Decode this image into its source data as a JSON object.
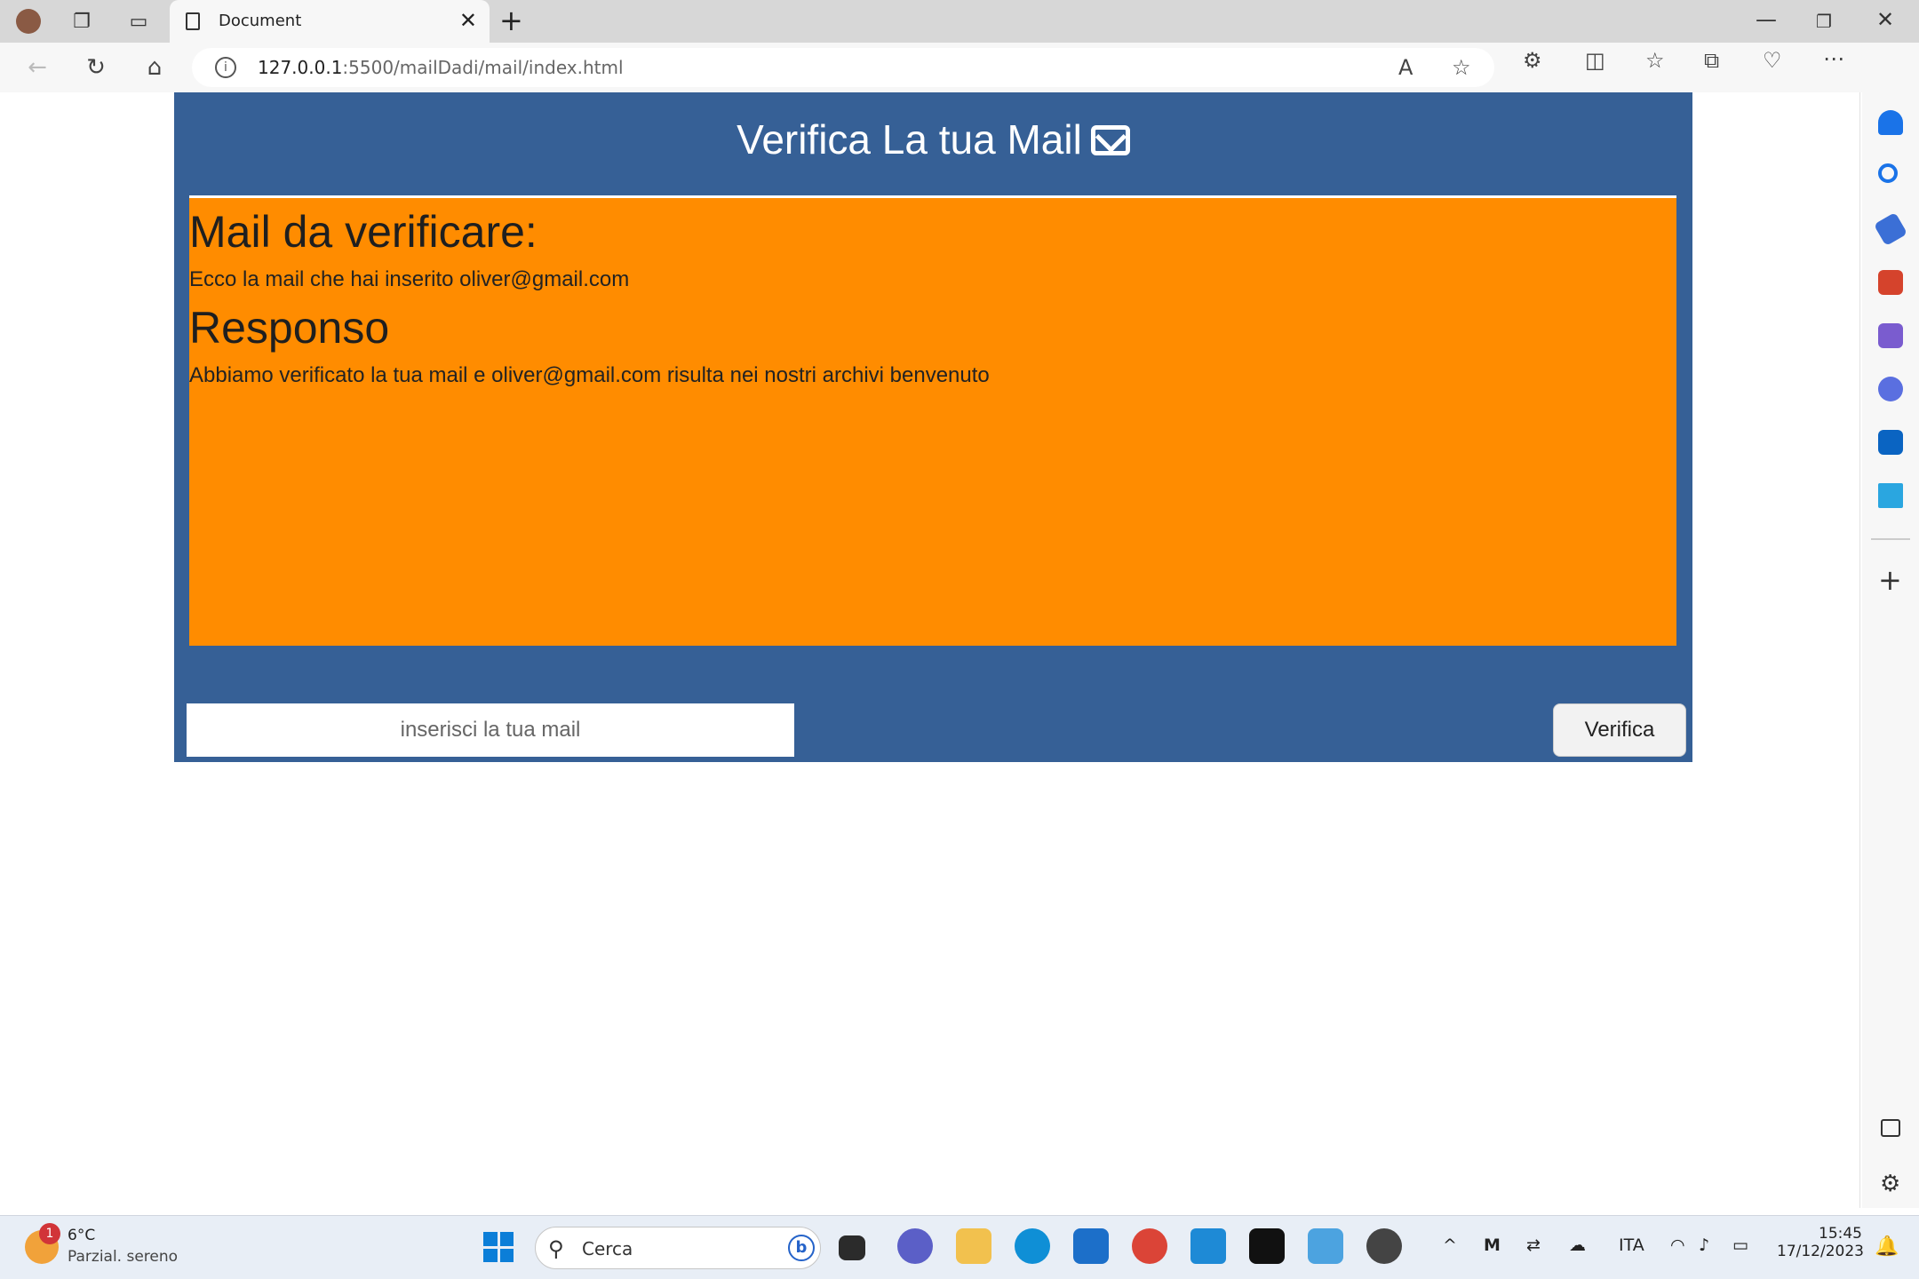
{
  "browser": {
    "tab_title": "Document",
    "url_main": "127.0.0.1",
    "url_rest": ":5500/mailDadi/mail/index.html"
  },
  "app": {
    "title": "Verifica La tua Mail",
    "section1_heading": "Mail da verificare:",
    "section1_text": "Ecco la mail che hai inserito oliver@gmail.com",
    "section2_heading": "Responso",
    "section2_text": "Abbiamo verificato la tua mail e oliver@gmail.com risulta nei nostri archivi benvenuto",
    "input_placeholder": "inserisci la tua mail",
    "button_label": "Verifica",
    "colors": {
      "header_bg": "#366096",
      "panel_bg": "#ff8c00"
    }
  },
  "taskbar": {
    "weather_badge": "1",
    "weather_temp": "6°C",
    "weather_desc": "Parzial. sereno",
    "search_label": "Cerca",
    "language": "ITA",
    "time": "15:45",
    "date": "17/12/2023"
  }
}
